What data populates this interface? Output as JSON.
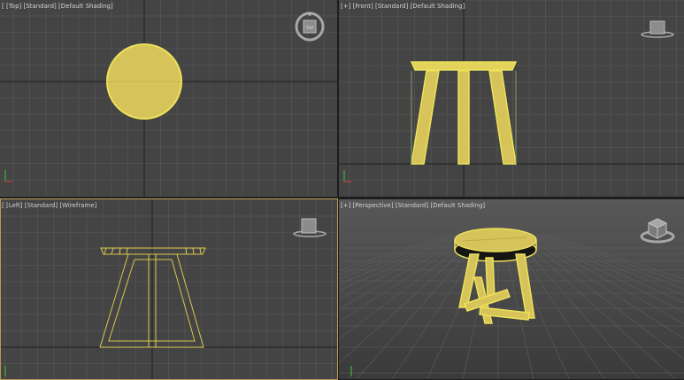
{
  "viewports": {
    "top": {
      "bracket": "[",
      "name": "[Top]",
      "mode": "[Standard]",
      "shading": "[Default Shading]",
      "view_cube_face": "TOP"
    },
    "front": {
      "bracket": "[+]",
      "name": "[Front]",
      "mode": "[Standard]",
      "shading": "[Default Shading]"
    },
    "left": {
      "bracket": "[",
      "name": "[Left]",
      "mode": "[Standard]",
      "shading": "[Wireframe]"
    },
    "persp": {
      "bracket": "[+]",
      "name": "[Perspective]",
      "mode": "[Standard]",
      "shading": "[Default Shading]"
    }
  },
  "colors": {
    "viewport_bg": "#444444",
    "grid_line": "#5a5a5a",
    "grid_axis": "#1e1e1e",
    "selection_yellow": "#ede25a",
    "object_fill": "#d6c35a",
    "active_border": "#b69a4f"
  },
  "icons": [
    "view-cube-icon",
    "axis-tripod-icon"
  ]
}
